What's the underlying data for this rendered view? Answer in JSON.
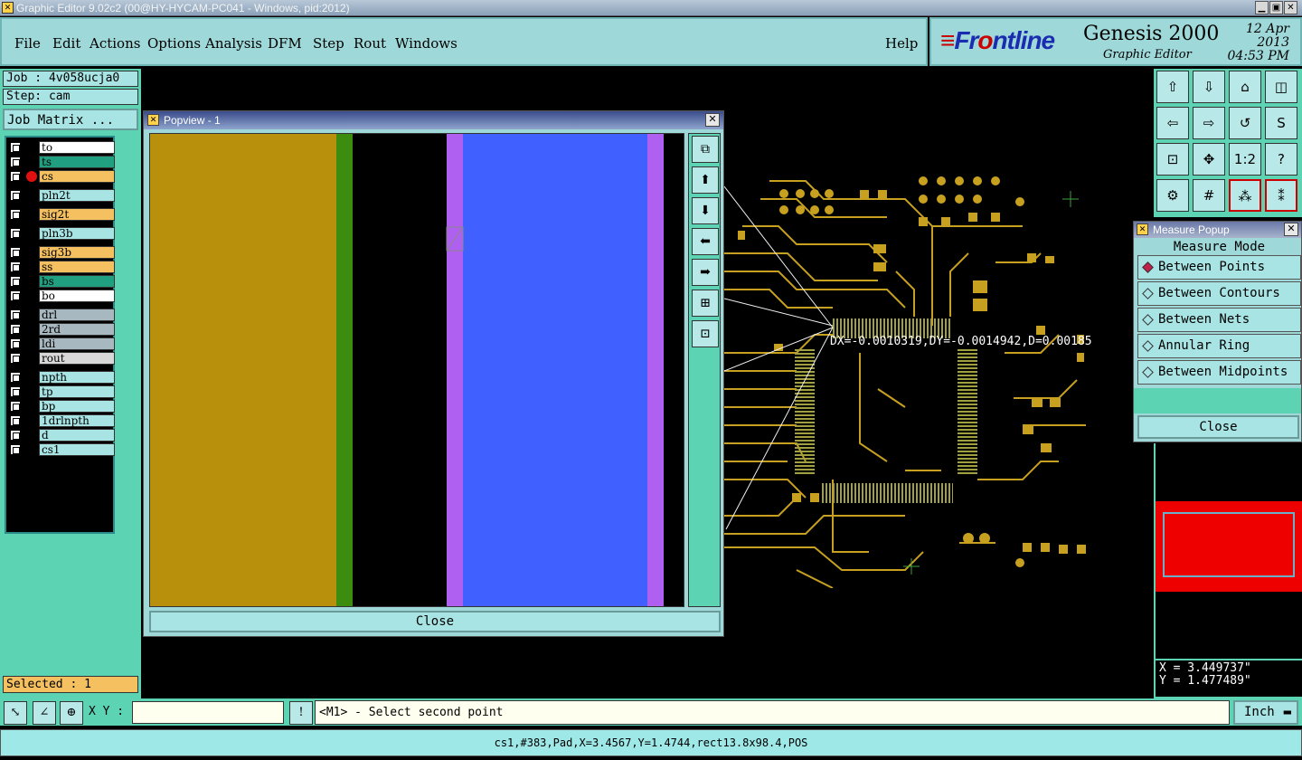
{
  "window": {
    "title": "Graphic Editor 9.02c2 (00@HY-HYCAM-PC041 - Windows, pid:2012)"
  },
  "menu": [
    "File",
    "Edit",
    "Actions",
    "Options",
    "Analysis",
    "DFM",
    "Step",
    "Rout",
    "Windows"
  ],
  "help": "Help",
  "brand": {
    "logo_prefix": "Fr",
    "logo_mid": "o",
    "logo_suffix": "ntline",
    "product": "Genesis 2000",
    "subtitle": "Graphic Editor",
    "date": "12 Apr 2013",
    "time": "04:53 PM"
  },
  "job": {
    "job": "Job : 4v058ucja0",
    "step": "Step: cam",
    "matrix_button": "Job Matrix ..."
  },
  "layers": [
    {
      "name": "to",
      "color": "#ffffff"
    },
    {
      "name": "ts",
      "color": "#20a080"
    },
    {
      "name": "cs",
      "color": "#f4c060",
      "active": true
    },
    {
      "name": "pln2t",
      "color": "#a8e4e4"
    },
    {
      "name": "sig2t",
      "color": "#f4c060"
    },
    {
      "name": "pln3b",
      "color": "#a8e4e4"
    },
    {
      "name": "sig3b",
      "color": "#f4c060"
    },
    {
      "name": "ss",
      "color": "#f4c060"
    },
    {
      "name": "bs",
      "color": "#20a080"
    },
    {
      "name": "bo",
      "color": "#ffffff"
    },
    {
      "name": "drl",
      "color": "#a8b8c0"
    },
    {
      "name": "2rd",
      "color": "#a8b8c0"
    },
    {
      "name": "ldi",
      "color": "#a8b8c0"
    },
    {
      "name": "rout",
      "color": "#d8d8d8"
    },
    {
      "name": "npth",
      "color": "#a8e4e4"
    },
    {
      "name": "tp",
      "color": "#a8e4e4"
    },
    {
      "name": "bp",
      "color": "#a8e4e4"
    },
    {
      "name": "1drlnpth",
      "color": "#a8e4e4"
    },
    {
      "name": "d",
      "color": "#a8e4e4"
    },
    {
      "name": "cs1",
      "color": "#a8e4e4"
    }
  ],
  "selected": "Selected : 1",
  "popview": {
    "title": "Popview - 1",
    "close": "Close"
  },
  "measure": {
    "title": "Measure Popup",
    "mode_label": "Measure Mode",
    "options": [
      "Between Points",
      "Between Contours",
      "Between Nets",
      "Annular Ring",
      "Between Midpoints"
    ],
    "selected_option": "Between Points",
    "close": "Close"
  },
  "measurement_readout": "DX=-0.0010319,DY=-0.0014942,D=0.00185",
  "coords": {
    "x": "X = 3.449737\"",
    "y": "Y = 1.477489\""
  },
  "bottom": {
    "xy_label": "X Y :",
    "xy_value": "",
    "prompt": "<M1> - Select second point",
    "units": "Inch"
  },
  "status": "cs1,#383,Pad,X=3.4567,Y=1.4744,rect13.8x98.4,POS",
  "colors": {
    "panel": "#5cd4b4",
    "menu": "#9fd8d8",
    "trace": "#c8a020",
    "pad": "#c8a020"
  }
}
